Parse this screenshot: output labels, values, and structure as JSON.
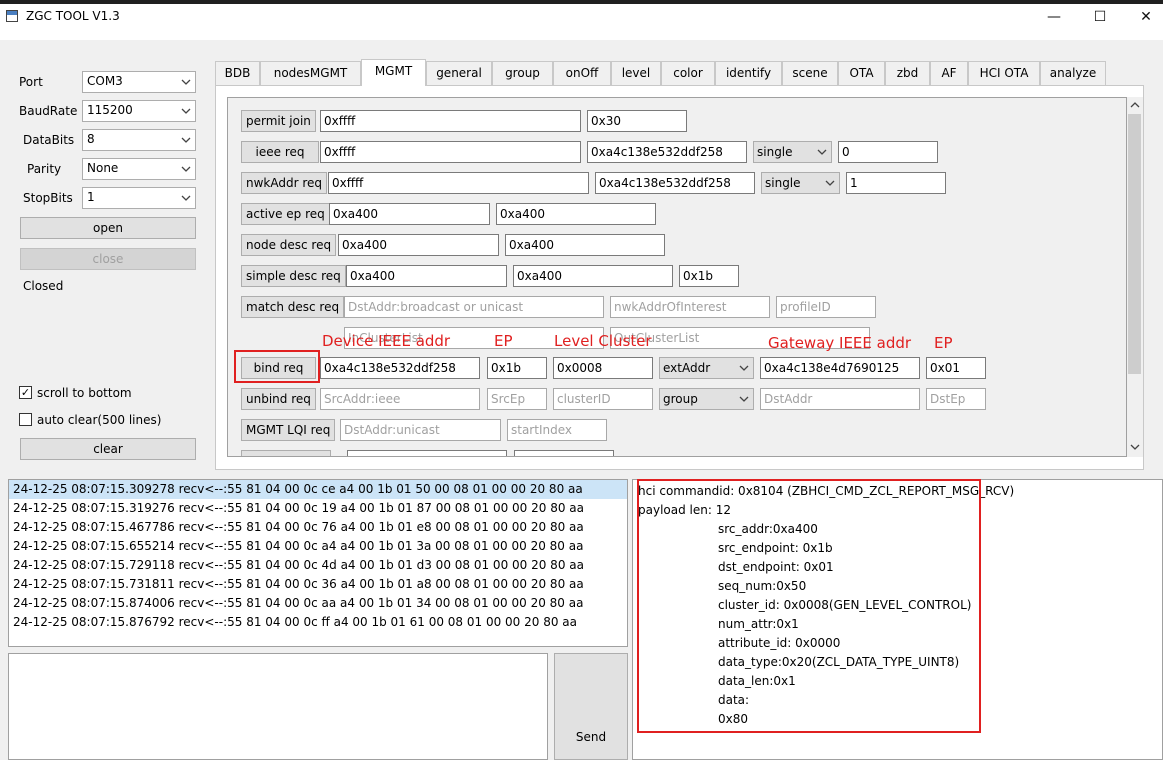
{
  "window": {
    "title": "ZGC TOOL V1.3",
    "min_glyph": "—",
    "max_glyph": "☐",
    "close_glyph": "✕"
  },
  "serial": {
    "port_label": "Port",
    "port_value": "COM3",
    "baud_label": "BaudRate",
    "baud_value": "115200",
    "databits_label": "DataBits",
    "databits_value": "8",
    "parity_label": "Parity",
    "parity_value": "None",
    "stopbits_label": "StopBits",
    "stopbits_value": "1",
    "open_label": "open",
    "close_label": "close",
    "status": "Closed",
    "scroll_label": "scroll to bottom",
    "scroll_checked": "✓",
    "autoclear_label": "auto clear(500 lines)",
    "clear_label": "clear"
  },
  "tabs": [
    "BDB",
    "nodesMGMT",
    "MGMT",
    "general",
    "group",
    "onOff",
    "level",
    "color",
    "identify",
    "scene",
    "OTA",
    "zbd",
    "AF",
    "HCI OTA",
    "analyze"
  ],
  "active_tab": "MGMT",
  "mgmt": {
    "permit_join": {
      "label": "permit join",
      "f1": "0xffff",
      "f2": "0x30"
    },
    "ieee_req": {
      "label": "ieee req",
      "f1": "0xffff",
      "f2": "0xa4c138e532ddf258",
      "mode": "single",
      "f3": "0"
    },
    "nwkaddr_req": {
      "label": "nwkAddr req",
      "f1": "0xffff",
      "f2": "0xa4c138e532ddf258",
      "mode": "single",
      "f3": "1"
    },
    "active_ep_req": {
      "label": "active ep req",
      "f1": "0xa400",
      "f2": "0xa400"
    },
    "node_desc_req": {
      "label": "node desc req",
      "f1": "0xa400",
      "f2": "0xa400"
    },
    "simple_desc_req": {
      "label": "simple desc req",
      "f1": "0xa400",
      "f2": "0xa400",
      "f3": "0x1b"
    },
    "match_desc_req": {
      "label": "match desc req",
      "ph1": "DstAddr:broadcast or unicast",
      "ph2": "nwkAddrOfInterest",
      "ph3": "profileID",
      "ph4": "InClusterList",
      "ph5": "OutClusterList"
    },
    "bind_req": {
      "label": "bind req",
      "f1": "0xa4c138e532ddf258",
      "f2": "0x1b",
      "f3": "0x0008",
      "mode": "extAddr",
      "f4": "0xa4c138e4d7690125",
      "f5": "0x01"
    },
    "unbind_req": {
      "label": "unbind req",
      "ph1": "SrcAddr:ieee",
      "ph2": "SrcEp",
      "ph3": "clusterID",
      "mode": "group",
      "ph4": "DstAddr",
      "ph5": "DstEp"
    },
    "lqi_req": {
      "label": "MGMT LQI req",
      "ph1": "DstAddr:unicast",
      "ph2": "startIndex"
    }
  },
  "annotations": {
    "device_ieee": "Device IEEE addr",
    "ep1": "EP",
    "level_cluster": "Level Cluster",
    "gateway_ieee": "Gateway IEEE addr",
    "ep2": "EP"
  },
  "log": [
    "24-12-25 08:07:15.309278 recv<--:55 81 04 00 0c ce a4 00 1b 01 50 00 08 01 00 00 20 80 aa",
    "24-12-25 08:07:15.319276 recv<--:55 81 04 00 0c 19 a4 00 1b 01 87 00 08 01 00 00 20 80 aa",
    "24-12-25 08:07:15.467786 recv<--:55 81 04 00 0c 76 a4 00 1b 01 e8 00 08 01 00 00 20 80 aa",
    "24-12-25 08:07:15.655214 recv<--:55 81 04 00 0c a4 a4 00 1b 01 3a 00 08 01 00 00 20 80 aa",
    "24-12-25 08:07:15.729118 recv<--:55 81 04 00 0c 4d a4 00 1b 01 d3 00 08 01 00 00 20 80 aa",
    "24-12-25 08:07:15.731811 recv<--:55 81 04 00 0c 36 a4 00 1b 01 a8 00 08 01 00 00 20 80 aa",
    "24-12-25 08:07:15.874006 recv<--:55 81 04 00 0c aa a4 00 1b 01 34 00 08 01 00 00 20 80 aa",
    "24-12-25 08:07:15.876792 recv<--:55 81 04 00 0c ff a4 00 1b 01 61 00 08 01 00 00 20 80 aa"
  ],
  "send_label": "Send",
  "detail": {
    "line1": "hci commandid: 0x8104 (ZBHCI_CMD_ZCL_REPORT_MSG_RCV)",
    "line2": "payload len: 12",
    "fields": [
      "src_addr:0xa400",
      "src_endpoint: 0x1b",
      "dst_endpoint: 0x01",
      "seq_num:0x50",
      "cluster_id: 0x0008(GEN_LEVEL_CONTROL)",
      "num_attr:0x1",
      "attribute_id: 0x0000",
      "data_type:0x20(ZCL_DATA_TYPE_UINT8)",
      "data_len:0x1",
      "data:",
      "0x80"
    ]
  }
}
